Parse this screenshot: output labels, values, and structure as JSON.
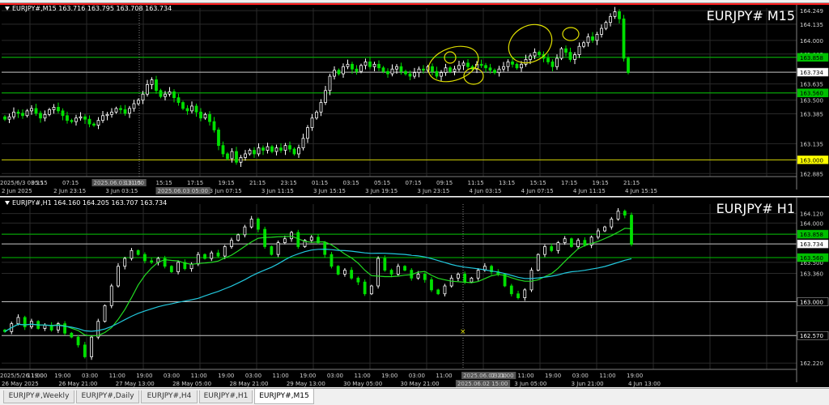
{
  "colors": {
    "bull": "#ffffff",
    "bear": "#00e000",
    "ma_fast": "#22dd22",
    "ma_slow": "#22c8dd",
    "grid": "#2a2a2a",
    "hline_green": "#00c000",
    "hline_yellow": "#d0d000",
    "annot": "#e0e000"
  },
  "m15": {
    "header": "EURJPY#,M15  163.716 163.795 163.708 163.734",
    "symbol": "EURJPY# M15",
    "y_axis": [
      "164.249",
      "164.135",
      "164.000",
      "163.885",
      "163.858",
      "163.734",
      "163.635",
      "163.560",
      "163.500",
      "163.385",
      "163.135",
      "163.000",
      "162.885"
    ],
    "x_axis": [
      "2025/6/3 03:15",
      "05:15",
      "07:15",
      "2025.06.03 11:00",
      "13:15",
      "15:15",
      "17:15",
      "19:15",
      "21:15",
      "23:15",
      "01:15",
      "03:15",
      "05:15",
      "07:15",
      "09:15",
      "11:15",
      "13:15",
      "15:15",
      "17:15",
      "19:15",
      "21:15"
    ],
    "x_axis2": [
      "2 Jun 2025",
      "2 Jun 23:15",
      "3 Jun 03:15",
      "2025.06.03 05:00",
      "3 Jun 07:15",
      "3 Jun 11:15",
      "3 Jun 15:15",
      "3 Jun 19:15",
      "3 Jun 23:15",
      "4 Jun 03:15",
      "4 Jun 07:15",
      "4 Jun 11:15",
      "4 Jun 15:15"
    ]
  },
  "h1": {
    "header": "EURJPY#,H1  164.160 164.205 163.707 163.734",
    "symbol": "EURJPY# H1",
    "y_axis": [
      "164.120",
      "164.000",
      "163.858",
      "163.734",
      "163.560",
      "163.500",
      "163.360",
      "163.000",
      "162.570",
      "162.220"
    ],
    "x_axis": [
      "2025/5/26 19:00",
      "11:00",
      "19:00",
      "03:00",
      "11:00",
      "19:00",
      "03:00",
      "11:00",
      "19:00",
      "03:00",
      "11:00",
      "19:00",
      "03:00",
      "11:00",
      "19:00",
      "03:00",
      "11:00",
      "2025.06.02 21:00",
      "03:00",
      "11:00",
      "19:00",
      "03:00",
      "11:00",
      "19:00"
    ],
    "x_axis2": [
      "26 May 2025",
      "26 May 21:00",
      "27 May 13:00",
      "28 May 05:00",
      "28 May 21:00",
      "29 May 13:00",
      "30 May 05:00",
      "30 May 21:00",
      "2025.06.02 15:00",
      "3 Jun 05:00",
      "3 Jun 21:00",
      "4 Jun 13:00"
    ]
  },
  "chart_data": [
    {
      "type": "candlestick",
      "title": "EURJPY# M15",
      "ylim": [
        162.86,
        164.27
      ],
      "close": [
        163.34,
        163.36,
        163.4,
        163.39,
        163.37,
        163.41,
        163.43,
        163.39,
        163.35,
        163.38,
        163.42,
        163.44,
        163.41,
        163.37,
        163.33,
        163.32,
        163.35,
        163.36,
        163.34,
        163.3,
        163.29,
        163.33,
        163.37,
        163.38,
        163.4,
        163.43,
        163.42,
        163.39,
        163.43,
        163.47,
        163.5,
        163.55,
        163.63,
        163.67,
        163.58,
        163.53,
        163.55,
        163.57,
        163.52,
        163.48,
        163.43,
        163.41,
        163.45,
        163.4,
        163.35,
        163.38,
        163.32,
        163.25,
        163.12,
        163.05,
        163.01,
        163.07,
        162.98,
        163.02,
        163.05,
        163.08,
        163.05,
        163.1,
        163.08,
        163.11,
        163.07,
        163.1,
        163.08,
        163.12,
        163.09,
        163.05,
        163.1,
        163.18,
        163.27,
        163.35,
        163.4,
        163.48,
        163.58,
        163.7,
        163.75,
        163.72,
        163.78,
        163.8,
        163.76,
        163.74,
        163.79,
        163.82,
        163.78,
        163.8,
        163.77,
        163.74,
        163.72,
        163.76,
        163.78,
        163.74,
        163.72,
        163.7,
        163.73,
        163.76,
        163.75,
        163.78,
        163.74,
        163.7,
        163.73,
        163.77,
        163.74,
        163.76,
        163.79,
        163.81,
        163.78,
        163.76,
        163.8,
        163.79,
        163.77,
        163.75,
        163.73,
        163.76,
        163.78,
        163.82,
        163.8,
        163.77,
        163.8,
        163.84,
        163.87,
        163.9,
        163.88,
        163.85,
        163.82,
        163.78,
        163.85,
        163.93,
        163.9,
        163.84,
        163.88,
        163.95,
        163.98,
        164.03,
        164.0,
        164.05,
        164.1,
        164.15,
        164.2,
        164.24,
        164.18,
        163.85,
        163.73
      ]
    },
    {
      "type": "candlestick",
      "title": "EURJPY# H1",
      "ylim": [
        162.14,
        164.24
      ],
      "series": [
        {
          "name": "",
          "values": []
        }
      ],
      "close": [
        162.62,
        162.72,
        162.8,
        162.68,
        162.75,
        162.66,
        162.7,
        162.64,
        162.72,
        162.6,
        162.55,
        162.45,
        162.3,
        162.55,
        162.75,
        162.95,
        163.2,
        163.45,
        163.55,
        163.65,
        163.6,
        163.52,
        163.5,
        163.55,
        163.45,
        163.38,
        163.5,
        163.42,
        163.48,
        163.6,
        163.55,
        163.62,
        163.58,
        163.7,
        163.78,
        163.85,
        163.95,
        164.05,
        163.92,
        163.7,
        163.6,
        163.75,
        163.8,
        163.88,
        163.7,
        163.78,
        163.82,
        163.75,
        163.6,
        163.45,
        163.35,
        163.4,
        163.3,
        163.25,
        163.1,
        163.2,
        163.55,
        163.4,
        163.35,
        163.45,
        163.4,
        163.3,
        163.35,
        163.28,
        163.15,
        163.1,
        163.2,
        163.3,
        163.35,
        163.25,
        163.3,
        163.4,
        163.45,
        163.38,
        163.35,
        163.2,
        163.1,
        163.05,
        163.15,
        163.4,
        163.6,
        163.7,
        163.65,
        163.75,
        163.8,
        163.7,
        163.78,
        163.72,
        163.82,
        163.9,
        163.95,
        164.05,
        164.15,
        164.1,
        163.73
      ]
    }
  ],
  "tabs": [
    {
      "label": "EURJPY#,Weekly"
    },
    {
      "label": "EURJPY#,Daily"
    },
    {
      "label": "EURJPY#,H4"
    },
    {
      "label": "EURJPY#,H1"
    },
    {
      "label": "EURJPY#,M15"
    }
  ]
}
